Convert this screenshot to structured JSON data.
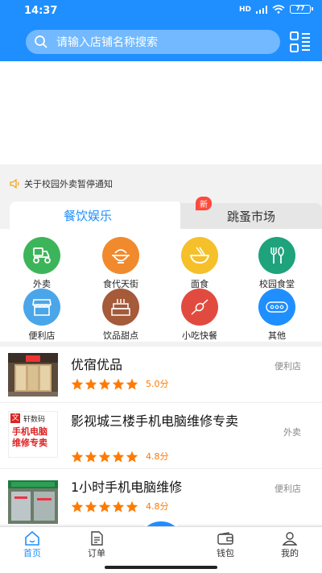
{
  "status": {
    "time": "14:37",
    "signal": "HD",
    "battery": "77"
  },
  "search": {
    "placeholder": "请输入店铺名称搜索"
  },
  "notice": {
    "text": "关于校园外卖暂停通知"
  },
  "tabs": [
    {
      "label": "餐饮娱乐",
      "active": true
    },
    {
      "label": "跳蚤市场",
      "badge": "新"
    }
  ],
  "categories": [
    {
      "label": "外卖",
      "icon": "scooter-icon",
      "color": "#3cb55a"
    },
    {
      "label": "食代天街",
      "icon": "bowl-icon",
      "color": "#f08a2c"
    },
    {
      "label": "面食",
      "icon": "noodles-icon",
      "color": "#f5c02a"
    },
    {
      "label": "校园食堂",
      "icon": "cutlery-icon",
      "color": "#1ea37c"
    },
    {
      "label": "便利店",
      "icon": "store-icon",
      "color": "#4aa6e8"
    },
    {
      "label": "饮品甜点",
      "icon": "cake-icon",
      "color": "#a55a3a"
    },
    {
      "label": "小吃快餐",
      "icon": "skewer-icon",
      "color": "#e14b3f"
    },
    {
      "label": "其他",
      "icon": "more-icon",
      "color": "#1f8fff"
    }
  ],
  "stores": [
    {
      "name": "优宿优品",
      "category": "便利店",
      "score": "5.0分",
      "thumb_text": ""
    },
    {
      "name": " 影视城三楼手机电脑维修专卖",
      "category": "外卖",
      "score": "4.8分",
      "thumb_text": "手机电脑维修专卖",
      "thumb_logo": "轩数码"
    },
    {
      "name": "1小时手机电脑维修",
      "category": "便利店",
      "score": "4.8分",
      "thumb_text": ""
    }
  ],
  "tabbar": [
    {
      "label": "首页",
      "icon": "home-icon",
      "active": true
    },
    {
      "label": "订单",
      "icon": "order-icon"
    },
    {
      "label": "钱包",
      "icon": "wallet-icon"
    },
    {
      "label": "我的",
      "icon": "profile-icon"
    }
  ],
  "colors": {
    "primary": "#1f8fff",
    "star": "#ff7a00"
  }
}
